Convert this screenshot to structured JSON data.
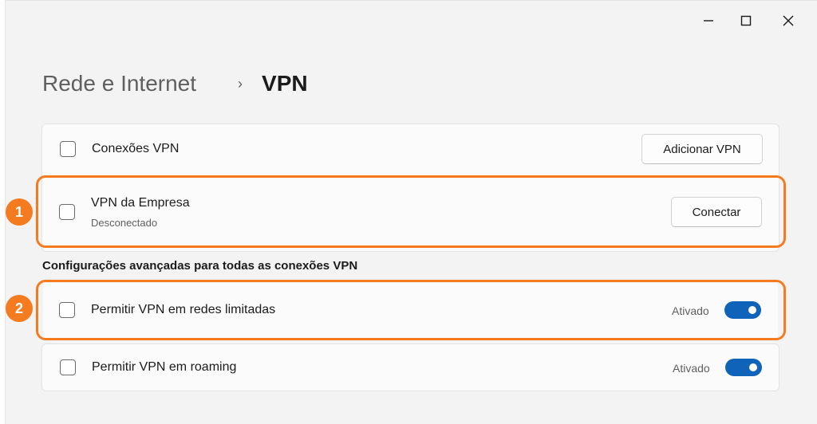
{
  "window": {
    "controls": {
      "minimize_icon": "minimize-icon",
      "maximize_icon": "maximize-icon",
      "close_icon": "close-icon"
    }
  },
  "breadcrumb": {
    "parent": "Rede e Internet",
    "separator": "›",
    "current": "VPN"
  },
  "vpn_connections": {
    "label": "Conexões VPN",
    "add_button": "Adicionar VPN"
  },
  "vpn_item": {
    "name": "VPN da Empresa",
    "status": "Desconectado",
    "connect_button": "Conectar"
  },
  "advanced": {
    "title": "Configurações avançadas para todas as conexões VPN",
    "settings": [
      {
        "label": "Permitir VPN em redes limitadas",
        "state": "Ativado",
        "on": true
      },
      {
        "label": "Permitir VPN em roaming",
        "state": "Ativado",
        "on": true
      }
    ]
  },
  "annotations": {
    "badge1": "1",
    "badge2": "2"
  },
  "colors": {
    "accent": "#0f63b8",
    "highlight": "#f47b20"
  }
}
